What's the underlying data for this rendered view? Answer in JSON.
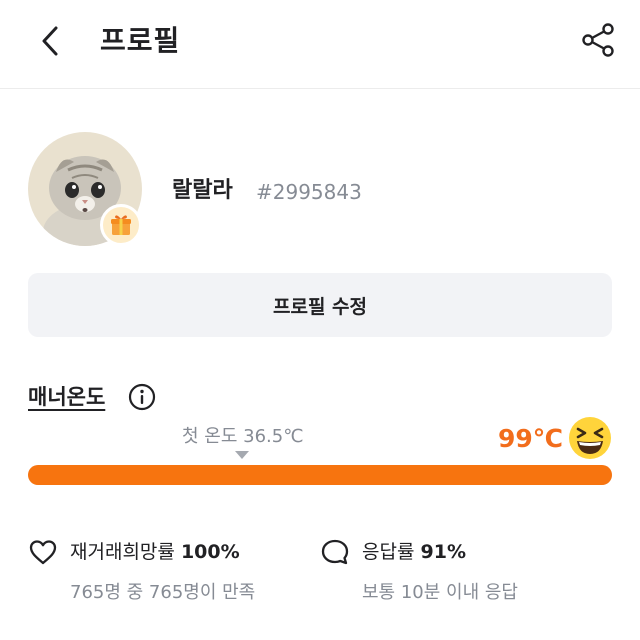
{
  "header": {
    "title": "프로필",
    "back_icon": "chevron-left-icon",
    "share_icon": "share-icon"
  },
  "profile": {
    "nickname": "랄랄라",
    "user_id": "#2995843",
    "avatar": "cat-photo",
    "badge_icon": "gift-icon",
    "edit_button_label": "프로필 수정"
  },
  "manner": {
    "title": "매너온도",
    "info_icon": "info-icon",
    "first_temp_label": "첫 온도 36.5℃",
    "current_temp": "99℃",
    "current_temp_value": 99,
    "temp_fraction": 1.0,
    "face_icon": "laughing-face-icon"
  },
  "stats": [
    {
      "icon": "heart-icon",
      "label": "재거래희망률",
      "value": "100%",
      "sub": "765명 중 765명이 만족"
    },
    {
      "icon": "chat-bubble-icon",
      "label": "응답률",
      "value": "91%",
      "sub": "보통 10분 이내 응답"
    }
  ],
  "colors": {
    "accent": "#f7740f",
    "temp_text": "#f26d1c",
    "muted_text": "#868b94",
    "button_bg": "#f2f3f6"
  }
}
